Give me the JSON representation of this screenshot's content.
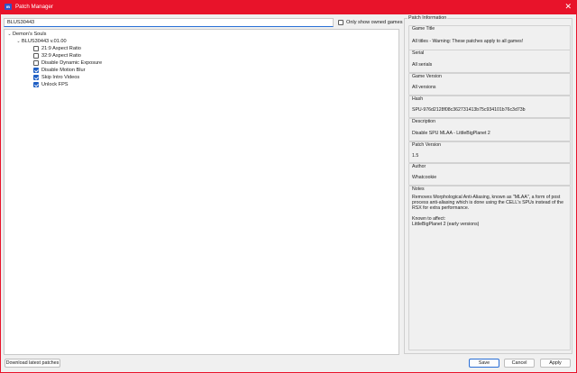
{
  "window": {
    "title": "Patch Manager",
    "close_glyph": "✕",
    "app_icon_text": "IB"
  },
  "filter": {
    "value": "BLUS30443"
  },
  "owned_checkbox": {
    "label": "Only show owned games",
    "checked": false
  },
  "tree": {
    "game": "Demon's Souls",
    "version": "BLUS30443 v.01.00",
    "patches": [
      {
        "label": "21:9 Aspect Ratio",
        "checked": false
      },
      {
        "label": "32:9 Aspect Ratio",
        "checked": false
      },
      {
        "label": "Disable Dynamic Exposure",
        "checked": false
      },
      {
        "label": "Disable Motion Blur",
        "checked": true
      },
      {
        "label": "Skip Intro Videos",
        "checked": true
      },
      {
        "label": "Unlock FPS",
        "checked": true
      }
    ]
  },
  "info": {
    "panel_title": "Patch Information",
    "game_title": {
      "label": "Game Title",
      "value": "All titles - Warning: These patches apply to all games!"
    },
    "serial": {
      "label": "Serial",
      "value": "All serials"
    },
    "game_version": {
      "label": "Game Version",
      "value": "All versions"
    },
    "hash": {
      "label": "Hash",
      "value": "SPU-976d2128f08c362731413b75c934101b76c3d73b"
    },
    "description": {
      "label": "Description",
      "value": "Disable SPU MLAA - LittleBigPlanet 2"
    },
    "patch_version": {
      "label": "Patch Version",
      "value": "1.5"
    },
    "author": {
      "label": "Author",
      "value": "Whatcookie"
    },
    "notes": {
      "label": "Notes",
      "paragraph1": "Removes Morphological Anti-Aliasing, known as \"MLAA\", a form of post process anti-aliasing which is done using the CELL's SPUs instead of the RSX for extra performance.",
      "affects_label": "Known to affect:",
      "affects_value": "LittleBigPlanet 2 (early versions)"
    }
  },
  "buttons": {
    "download": "Download latest patches",
    "save": "Save",
    "cancel": "Cancel",
    "apply": "Apply"
  }
}
